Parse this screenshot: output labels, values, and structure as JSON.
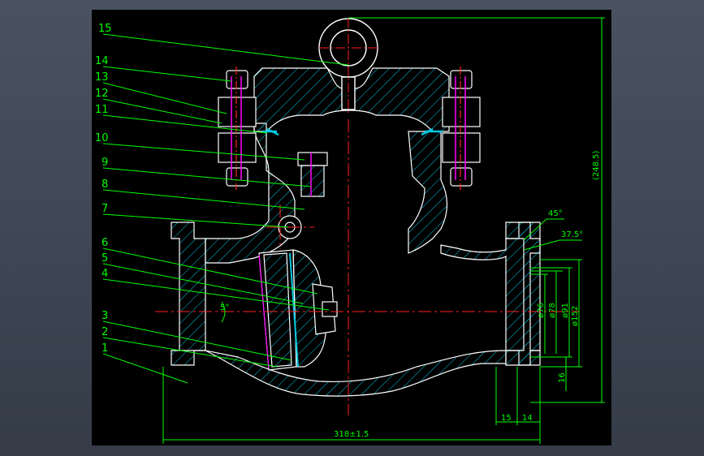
{
  "drawing": {
    "part_labels": [
      {
        "num": "15"
      },
      {
        "num": "14"
      },
      {
        "num": "13"
      },
      {
        "num": "12"
      },
      {
        "num": "11"
      },
      {
        "num": "10"
      },
      {
        "num": "9"
      },
      {
        "num": "8"
      },
      {
        "num": "7"
      },
      {
        "num": "6"
      },
      {
        "num": "5"
      },
      {
        "num": "4"
      },
      {
        "num": "3"
      },
      {
        "num": "2"
      },
      {
        "num": "1"
      }
    ],
    "dimensions": {
      "overall_length": "318±1.5",
      "height": "(248.5)",
      "dia_76": "ø76",
      "dia_78": "ø78",
      "dia_91": "ø91",
      "dia_152": "ø152",
      "dim_16": "16",
      "dim_15": "15",
      "dim_14": "14",
      "angle_45": "45°",
      "angle_37_5": "37.5°",
      "angle_5": "5°"
    },
    "colors": {
      "outline": "#ffffff",
      "hatch": "#00c8e0",
      "dimension": "#00ff00",
      "centerline": "#ff2020",
      "leader": "#00ff00",
      "bolt": "#ff00ff"
    }
  }
}
